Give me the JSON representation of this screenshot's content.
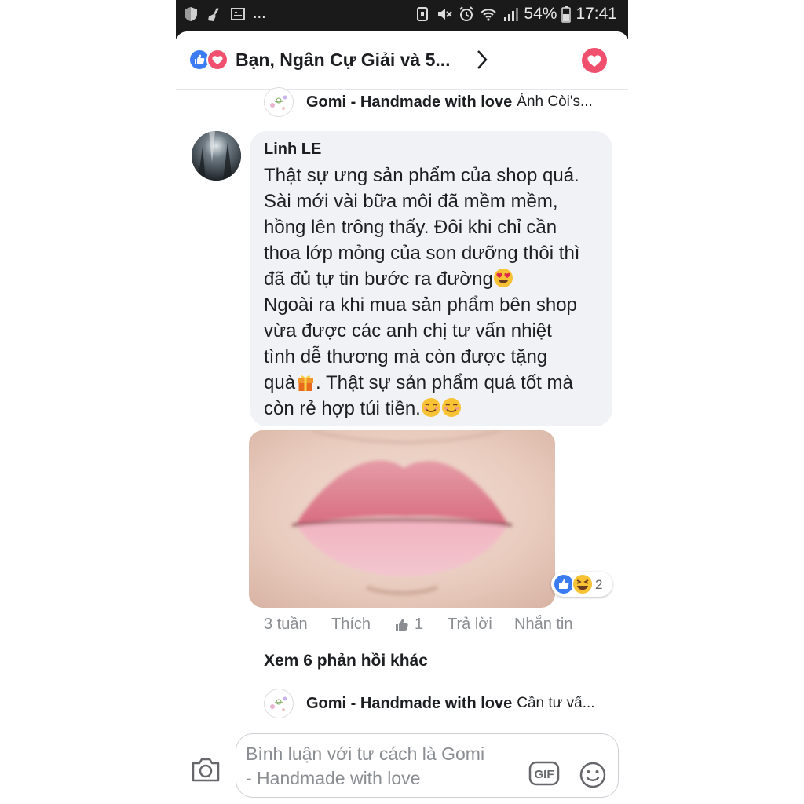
{
  "status_bar": {
    "battery_percent": "54%",
    "time": "17:41",
    "notification_ellipsis": "..."
  },
  "header": {
    "title": "Bạn, Ngân Cự Giải và 5..."
  },
  "replies": [
    {
      "author": "Gomi - Handmade with love",
      "preview": "Ánh Còi's..."
    },
    {
      "author": "Gomi - Handmade with love",
      "preview": "Cần tư vấ..."
    }
  ],
  "comment": {
    "author": "Linh LE",
    "lines": [
      "Thật sự ưng sản phẩm của shop quá.",
      "Sài mới vài bữa môi đã mềm mềm,",
      "hồng lên trông thấy. Đôi khi chỉ cần",
      "thoa lớp mỏng của son dưỡng thôi thì",
      "đã đủ tự tin bước ra đường",
      "Ngoài ra khi mua sản phẩm bên shop",
      "vừa được các anh chị tư vấn nhiệt",
      "tình dễ thương mà còn được tặng",
      "quà",
      ". Thật sự sản phẩm quá tốt mà",
      "còn rẻ hợp túi tiền."
    ],
    "reaction_count": "2",
    "time_ago": "3 tuần",
    "like_label": "Thích",
    "like_count": "1",
    "reply_label": "Trả lời",
    "message_label": "Nhắn tin"
  },
  "see_more_replies": "Xem 6 phản hồi khác",
  "composer": {
    "placeholder_line1": "Bình luận với tư cách là Gomi",
    "placeholder_line2": "- Handmade with love",
    "gif_label": "GIF"
  },
  "colors": {
    "like_blue": "#3b7cf2",
    "love_red": "#f0506e",
    "bubble_gray": "#f0f2f5",
    "meta_gray": "#8a8d91"
  },
  "icons": [
    "shield-icon",
    "broom-icon",
    "image-icon",
    "nfc-icon",
    "mute-icon",
    "alarm-icon",
    "wifi-icon",
    "signal-icon",
    "battery-icon",
    "like-icon",
    "love-icon",
    "chevron-right-icon",
    "heart-button-icon",
    "camera-icon",
    "gif-icon",
    "smiley-icon"
  ]
}
